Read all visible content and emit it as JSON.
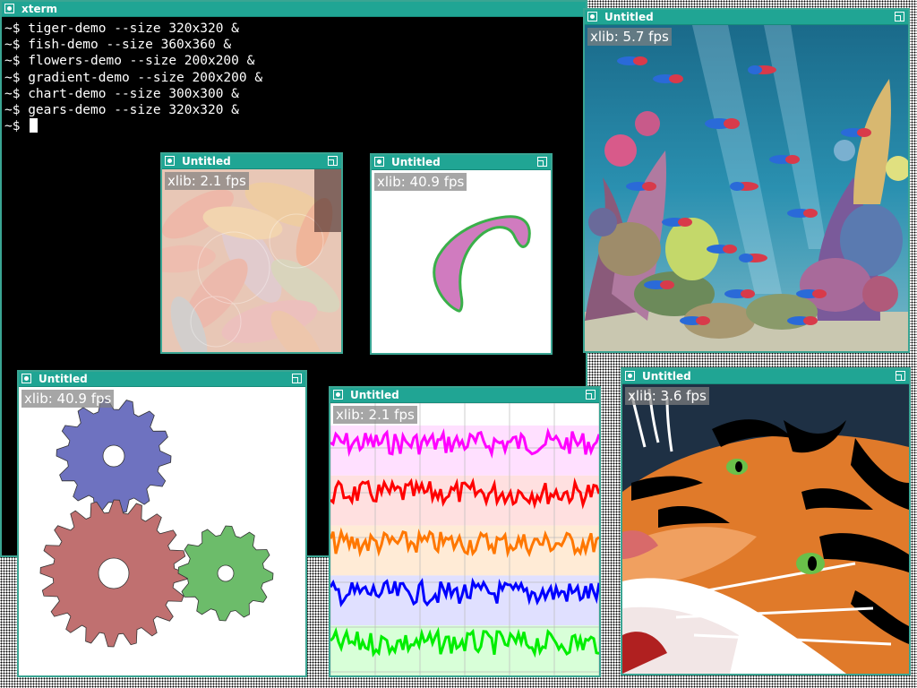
{
  "xterm": {
    "title": "xterm",
    "lines": [
      "~$ tiger-demo --size 320x320 &",
      "~$ fish-demo --size 360x360 &",
      "~$ flowers-demo --size 200x200 &",
      "~$ gradient-demo --size 200x200 &",
      "~$ chart-demo --size 300x300 &",
      "~$ gears-demo --size 320x320 &"
    ],
    "prompt": "~$ "
  },
  "windows": {
    "flowers": {
      "title": "Untitled",
      "fps": "xlib: 2.1 fps"
    },
    "gradient": {
      "title": "Untitled",
      "fps": "xlib: 40.9 fps"
    },
    "fish": {
      "title": "Untitled",
      "fps": "xlib: 5.7 fps"
    },
    "gears": {
      "title": "Untitled",
      "fps": "xlib: 40.9 fps"
    },
    "chart": {
      "title": "Untitled",
      "fps": "xlib: 2.1 fps"
    },
    "tiger": {
      "title": "Untitled",
      "fps": "xlib: 3.6 fps"
    }
  },
  "colors": {
    "titlebar": "#20a594",
    "border": "#3aa593",
    "chart_series": [
      "#ff00ff",
      "#ff0000",
      "#ff7700",
      "#0000ff",
      "#00ee00"
    ]
  },
  "icons": {
    "window_menu": "window-menu-icon",
    "maximize": "maximize-icon"
  }
}
